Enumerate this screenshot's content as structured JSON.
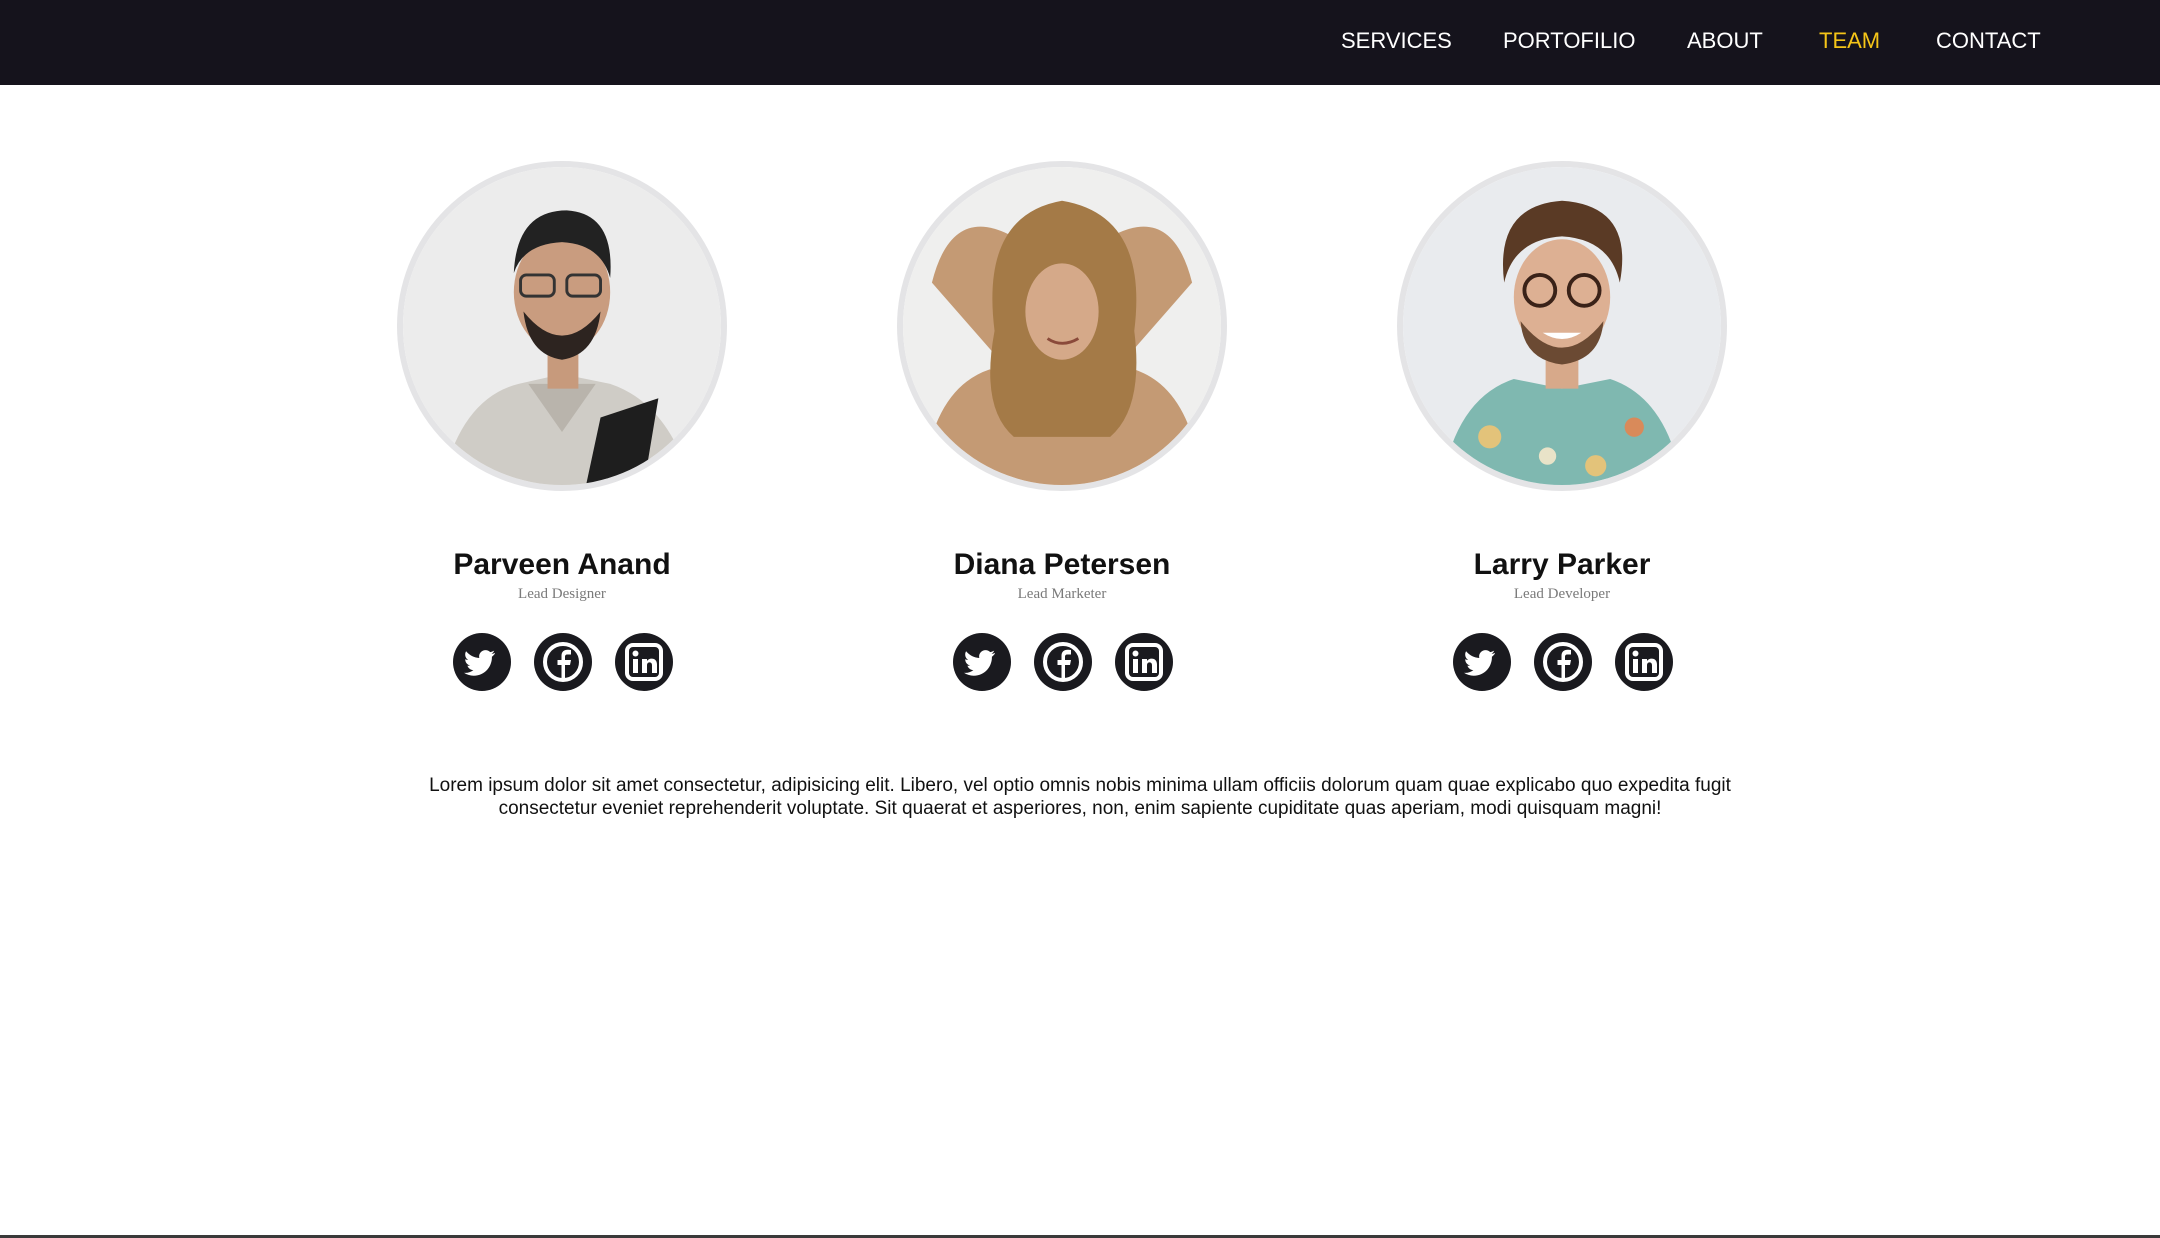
{
  "nav": {
    "items": [
      {
        "label": "SERVICES",
        "active": false
      },
      {
        "label": "PORTOFILIO",
        "active": false
      },
      {
        "label": "ABOUT",
        "active": false
      },
      {
        "label": "TEAM",
        "active": true
      },
      {
        "label": "CONTACT",
        "active": false
      }
    ],
    "colors": {
      "background": "#15131c",
      "text": "#ffffff",
      "active": "#f5c518"
    }
  },
  "team": [
    {
      "name": "Parveen Anand",
      "role": "Lead Designer",
      "social": [
        "twitter-icon",
        "facebook-icon",
        "linkedin-icon"
      ]
    },
    {
      "name": "Diana Petersen",
      "role": "Lead Marketer",
      "social": [
        "twitter-icon",
        "facebook-icon",
        "linkedin-icon"
      ]
    },
    {
      "name": "Larry Parker",
      "role": "Lead Developer",
      "social": [
        "twitter-icon",
        "facebook-icon",
        "linkedin-icon"
      ]
    }
  ],
  "description": "Lorem ipsum dolor sit amet consectetur, adipisicing elit. Libero, vel optio omnis nobis minima ullam officiis dolorum quam quae explicabo quo expedita fugit consectetur eveniet reprehenderit voluptate. Sit quaerat et asperiores, non, enim sapiente cupiditate quas aperiam, modi quisquam magni!"
}
